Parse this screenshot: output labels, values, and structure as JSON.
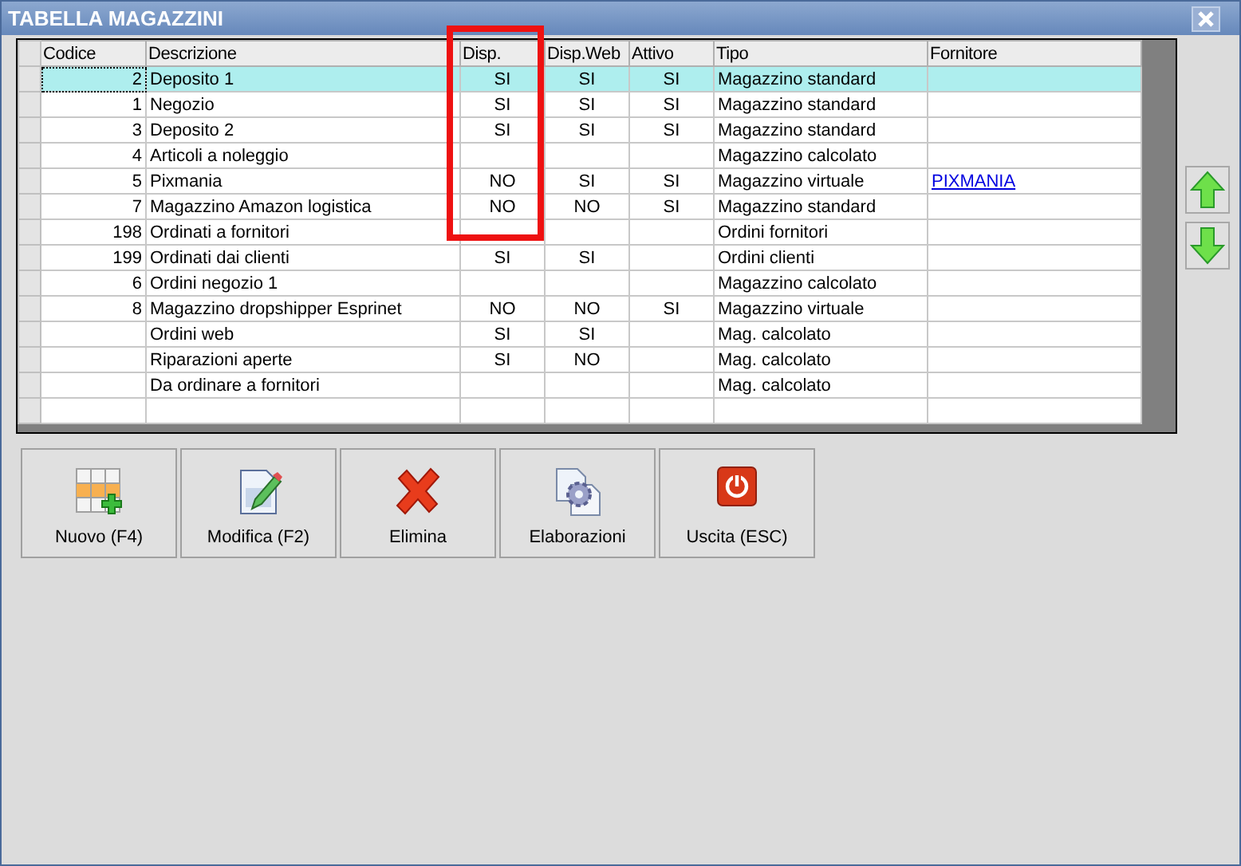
{
  "window": {
    "title": "TABELLA MAGAZZINI"
  },
  "table": {
    "columns": [
      "Codice",
      "Descrizione",
      "Disp.",
      "Disp.Web",
      "Attivo",
      "Tipo",
      "Fornitore"
    ],
    "rows": [
      {
        "selected": true,
        "codice": "2",
        "descrizione": "Deposito 1",
        "disp": "SI",
        "disp_web": "SI",
        "attivo": "SI",
        "tipo": "Magazzino standard"
      },
      {
        "selected": false,
        "codice": "1",
        "descrizione": "Negozio",
        "disp": "SI",
        "disp_web": "SI",
        "attivo": "SI",
        "tipo": "Magazzino standard"
      },
      {
        "selected": false,
        "codice": "3",
        "descrizione": "Deposito 2",
        "disp": "SI",
        "disp_web": "SI",
        "attivo": "SI",
        "tipo": "Magazzino standard"
      },
      {
        "selected": false,
        "codice": "4",
        "descrizione": "Articoli a noleggio",
        "tipo": "Magazzino calcolato"
      },
      {
        "selected": false,
        "codice": "5",
        "descrizione": "Pixmania",
        "disp": "NO",
        "disp_web": "SI",
        "attivo": "SI",
        "tipo": "Magazzino virtuale",
        "fornitore": "PIXMANIA"
      },
      {
        "selected": false,
        "codice": "7",
        "descrizione": "Magazzino Amazon logistica",
        "disp": "NO",
        "disp_web": "NO",
        "attivo": "SI",
        "tipo": "Magazzino standard"
      },
      {
        "selected": false,
        "codice": "198",
        "descrizione": "Ordinati a fornitori",
        "tipo": "Ordini fornitori"
      },
      {
        "selected": false,
        "codice": "199",
        "descrizione": "Ordinati dai clienti",
        "disp": "SI",
        "disp_web": "SI",
        "tipo": "Ordini clienti"
      },
      {
        "selected": false,
        "codice": "6",
        "descrizione": "Ordini negozio 1",
        "tipo": "Magazzino calcolato"
      },
      {
        "selected": false,
        "codice": "8",
        "descrizione": "Magazzino dropshipper Esprinet",
        "disp": "NO",
        "disp_web": "NO",
        "attivo": "SI",
        "tipo": "Magazzino virtuale"
      },
      {
        "selected": false,
        "descrizione": "Ordini web",
        "disp": "SI",
        "disp_web": "SI",
        "tipo": "Mag. calcolato"
      },
      {
        "selected": false,
        "descrizione": "Riparazioni aperte",
        "disp": "SI",
        "disp_web": "NO",
        "tipo": "Mag. calcolato"
      },
      {
        "selected": false,
        "descrizione": "Da ordinare a fornitori",
        "tipo": "Mag. calcolato"
      }
    ]
  },
  "buttons": [
    {
      "kind": "new",
      "label": "Nuovo (F4)"
    },
    {
      "kind": "edit",
      "label": "Modifica (F2)"
    },
    {
      "kind": "delete",
      "label": "Elimina"
    },
    {
      "kind": "process",
      "label": "Elaborazioni"
    },
    {
      "kind": "exit",
      "label": "Uscita (ESC)"
    }
  ]
}
